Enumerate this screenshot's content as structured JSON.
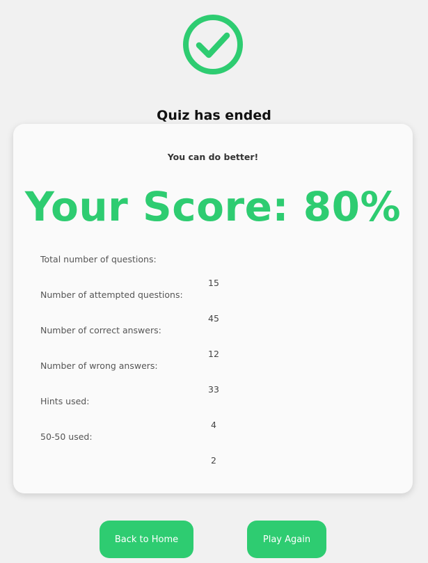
{
  "header": {
    "title": "Quiz has ended",
    "icon": "check-circle-icon",
    "accent_color": "#2ecc71"
  },
  "result": {
    "remark": "You can do better!",
    "score_text": "Your Score: 80%",
    "score_percent": 80
  },
  "stats": [
    {
      "label": "Total number of questions:",
      "value": "15"
    },
    {
      "label": "Number of attempted questions:",
      "value": "45"
    },
    {
      "label": "Number of correct answers:",
      "value": "12"
    },
    {
      "label": "Number of wrong answers:",
      "value": "33"
    },
    {
      "label": "Hints used:",
      "value": "4"
    },
    {
      "label": "50-50 used:",
      "value": "2"
    }
  ],
  "actions": {
    "back_home_label": "Back to Home",
    "play_again_label": "Play Again"
  }
}
